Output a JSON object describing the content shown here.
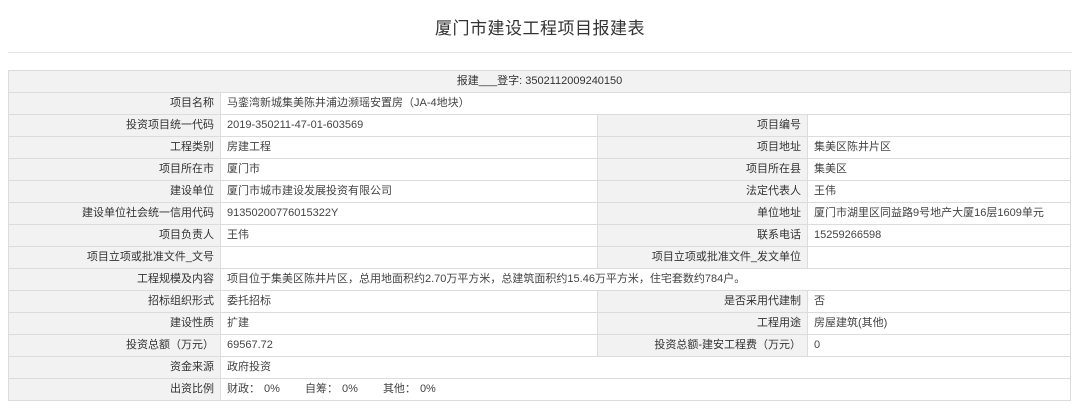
{
  "page": {
    "title": "厦门市建设工程项目报建表"
  },
  "header": {
    "text": "报建___登字: 3502112009240150"
  },
  "rows": {
    "project_name_label": "项目名称",
    "project_name_value": "马銮湾新城集美陈井浦边濒瑶安置房（JA-4地块）",
    "invest_code_label": "投资项目统一代码",
    "invest_code_value": "2019-350211-47-01-603569",
    "project_no_label": "项目编号",
    "project_no_value": "",
    "category_label": "工程类别",
    "category_value": "房建工程",
    "location_label": "项目地址",
    "location_value": "集美区陈井片区",
    "city_label": "项目所在市",
    "city_value": "厦门市",
    "county_label": "项目所在县",
    "county_value": "集美区",
    "builder_label": "建设单位",
    "builder_value": "厦门市城市建设发展投资有限公司",
    "legal_rep_label": "法定代表人",
    "legal_rep_value": "王伟",
    "credit_code_label": "建设单位社会统一信用代码",
    "credit_code_value": "91350200776015322Y",
    "unit_address_label": "单位地址",
    "unit_address_value": "厦门市湖里区同益路9号地产大厦16层1609单元",
    "manager_label": "项目负责人",
    "manager_value": "王伟",
    "phone_label": "联系电话",
    "phone_value": "15259266598",
    "approval_doc_label": "项目立项或批准文件_文号",
    "approval_doc_value": "",
    "approval_unit_label": "项目立项或批准文件_发文单位",
    "approval_unit_value": "",
    "scale_label": "工程规模及内容",
    "scale_value": "项目位于集美区陈井片区，总用地面积约2.70万平方米，总建筑面积约15.46万平方米，住宅套数约784户。",
    "bidding_form_label": "招标组织形式",
    "bidding_form_value": "委托招标",
    "agent_label": "是否采用代建制",
    "agent_value": "否",
    "nature_label": "建设性质",
    "nature_value": "扩建",
    "usage_label": "工程用途",
    "usage_value": "房屋建筑(其他)",
    "total_invest_label": "投资总额（万元）",
    "total_invest_value": "69567.72",
    "install_cost_label": "投资总额-建安工程费（万元）",
    "install_cost_value": "0",
    "fund_source_label": "资金来源",
    "fund_source_value": "政府投资",
    "ratio_label": "出资比例",
    "ratio": {
      "fiscal_label": "财政：",
      "fiscal_value": "0%",
      "self_label": "自筹：",
      "self_value": "0%",
      "other_label": "其他：",
      "other_value": "0%"
    }
  }
}
